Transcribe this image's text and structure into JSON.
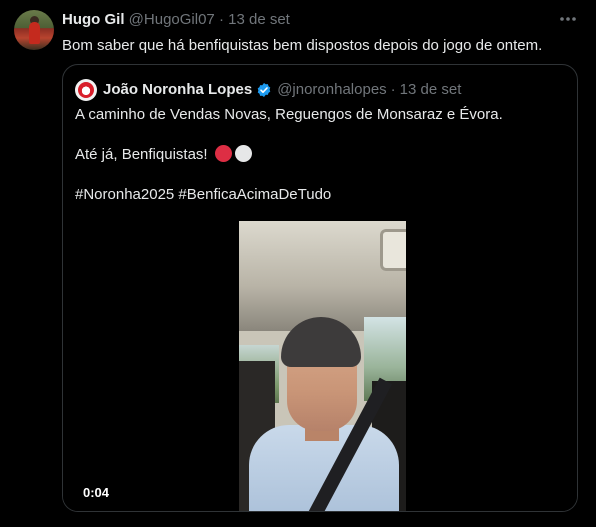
{
  "tweet": {
    "author_name": "Hugo Gil",
    "handle": "@HugoGil07",
    "separator": "·",
    "date": "13 de set",
    "text": "Bom saber que há benfiquistas bem dispostos depois do jogo de ontem.",
    "more_icon": "more-icon"
  },
  "quote": {
    "author_name": "João Noronha Lopes",
    "verified_icon": "verified-badge-icon",
    "handle": "@jnoronhalopes",
    "separator": "·",
    "date": "13 de set",
    "line1": "A caminho de Vendas Novas, Reguengos de Monsaraz e Évora.",
    "line2": "Até já, Benfiquistas!",
    "line3": "#Noronha2025 #BenficaAcimaDeTudo",
    "emojis": [
      "red-circle",
      "white-circle"
    ],
    "video_time": "0:04"
  }
}
